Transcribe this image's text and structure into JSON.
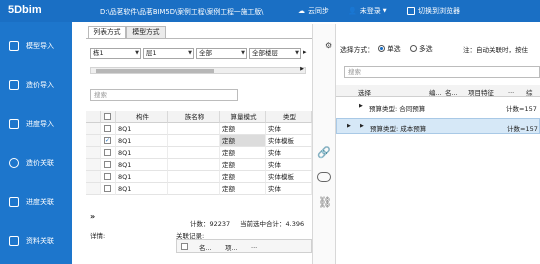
{
  "app": {
    "logo": "5Dbim",
    "path": "D:\\品茗软件\\品茗BIM5D\\案例工程\\案例工程一施工版\\",
    "sync": "云同步",
    "login": "未登录",
    "browser": "切换到浏览器"
  },
  "sidebar": {
    "items": [
      {
        "label": "模型导入"
      },
      {
        "label": "造价导入"
      },
      {
        "label": "进度导入"
      },
      {
        "label": "造价关联"
      },
      {
        "label": "进度关联"
      },
      {
        "label": "资料关联"
      }
    ]
  },
  "left": {
    "tabs": [
      "列表方式",
      "模型方式"
    ],
    "filters": [
      "栋1",
      "层1",
      "全部",
      "全部楼层"
    ],
    "search_placeholder": "搜索",
    "columns": [
      "构件",
      "族名称",
      "算量模式",
      "类型"
    ],
    "rows": [
      {
        "name": "8Q1",
        "family": "",
        "mode": "定额",
        "type": "实体",
        "checked": false
      },
      {
        "name": "8Q1",
        "family": "",
        "mode": "定额",
        "type": "实体模板",
        "checked": true
      },
      {
        "name": "8Q1",
        "family": "",
        "mode": "定额",
        "type": "实体",
        "checked": false
      },
      {
        "name": "8Q1",
        "family": "",
        "mode": "定额",
        "type": "实体",
        "checked": false
      },
      {
        "name": "8Q1",
        "family": "",
        "mode": "定额",
        "type": "实体模板",
        "checked": false
      },
      {
        "name": "8Q1",
        "family": "",
        "mode": "定额",
        "type": "实体",
        "checked": false
      }
    ],
    "count": "计数：92237",
    "total": "当前选中合计：4.396",
    "details_label": "详情:",
    "relation_label": "关联记录:",
    "relation_cols": [
      "名...",
      "项...",
      "..."
    ]
  },
  "right": {
    "select_mode_label": "选择方式：",
    "mode_single": "单选",
    "mode_multi": "多选",
    "hint": "注：自动关联时，按住",
    "search_placeholder": "搜索",
    "columns": [
      "选择",
      "编...",
      "名...",
      "项目特征",
      "...",
      "综"
    ],
    "groups": [
      {
        "label": "预算类型: 合同预算",
        "count": "计数=157"
      },
      {
        "label": "预算类型: 成本预算",
        "count": "计数=157"
      }
    ]
  },
  "colors": {
    "blue": "#1a6fc4",
    "sidebar": "#1d76cc",
    "select": "#d6e8f7"
  }
}
